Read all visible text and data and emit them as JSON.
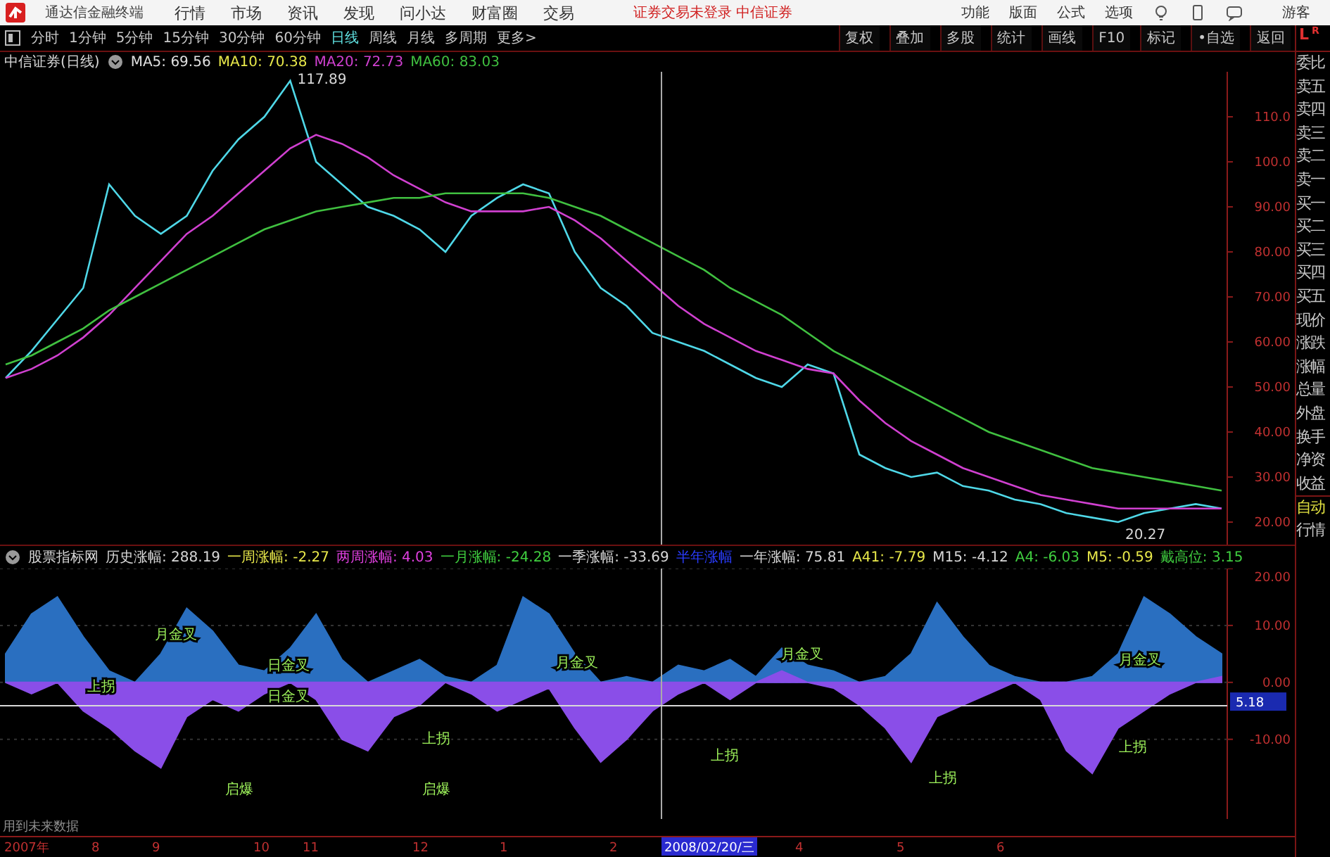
{
  "menu_bar": {
    "app_title": "通达信金融终端",
    "menus": [
      "行情",
      "市场",
      "资讯",
      "发现",
      "问小达",
      "财富圈",
      "交易"
    ],
    "notice": "证券交易未登录 中信证券",
    "right_menus": [
      "功能",
      "版面",
      "公式",
      "选项"
    ],
    "user": "游客"
  },
  "toolbar": {
    "periods": [
      {
        "label": "分时",
        "selected": false
      },
      {
        "label": "1分钟",
        "selected": false
      },
      {
        "label": "5分钟",
        "selected": false
      },
      {
        "label": "15分钟",
        "selected": false
      },
      {
        "label": "30分钟",
        "selected": false
      },
      {
        "label": "60分钟",
        "selected": false
      },
      {
        "label": "日线",
        "selected": true
      },
      {
        "label": "周线",
        "selected": false
      },
      {
        "label": "月线",
        "selected": false
      },
      {
        "label": "多周期",
        "selected": false
      },
      {
        "label": "更多>",
        "selected": false
      }
    ],
    "buttons": [
      "复权",
      "叠加",
      "多股",
      "统计",
      "画线",
      "F10",
      "标记",
      "•自选",
      "返回"
    ]
  },
  "price_pane": {
    "title": "中信证券(日线)",
    "legend": [
      {
        "text": "MA5: 69.56",
        "color": "#e0e0e0"
      },
      {
        "text": "MA10: 70.38",
        "color": "#e8e84a"
      },
      {
        "text": "MA20: 72.73",
        "color": "#d040d0"
      },
      {
        "text": "MA60: 83.03",
        "color": "#40c040"
      }
    ],
    "chart_data": {
      "type": "line",
      "ylim": [
        15,
        120
      ],
      "yticks": [
        {
          "value": 110,
          "label": "110.0"
        },
        {
          "value": 100,
          "label": "100.0"
        },
        {
          "value": 90,
          "label": "90.00"
        },
        {
          "value": 80,
          "label": "80.00"
        },
        {
          "value": 70,
          "label": "70.00"
        },
        {
          "value": 60,
          "label": "60.00"
        },
        {
          "value": 50,
          "label": "50.00"
        },
        {
          "value": 40,
          "label": "40.00"
        },
        {
          "value": 30,
          "label": "30.00"
        },
        {
          "value": 20,
          "label": "20.00"
        }
      ],
      "series": [
        {
          "color": "#4fd8e8",
          "values": [
            52,
            58,
            65,
            72,
            95,
            88,
            84,
            88,
            98,
            105,
            110,
            118,
            100,
            95,
            90,
            88,
            85,
            80,
            88,
            92,
            95,
            93,
            80,
            72,
            68,
            62,
            60,
            58,
            55,
            52,
            50,
            55,
            53,
            35,
            32,
            30,
            31,
            28,
            27,
            25,
            24,
            22,
            21,
            20,
            22,
            23,
            24,
            23
          ]
        },
        {
          "color": "#d040d0",
          "values": [
            52,
            54,
            57,
            61,
            66,
            72,
            78,
            84,
            88,
            93,
            98,
            103,
            106,
            104,
            101,
            97,
            94,
            91,
            89,
            89,
            89,
            90,
            87,
            83,
            78,
            73,
            68,
            64,
            61,
            58,
            56,
            54,
            53,
            47,
            42,
            38,
            35,
            32,
            30,
            28,
            26,
            25,
            24,
            23,
            23,
            23,
            23,
            23
          ]
        },
        {
          "color": "#40c040",
          "values": [
            55,
            57,
            60,
            63,
            67,
            70,
            73,
            76,
            79,
            82,
            85,
            87,
            89,
            90,
            91,
            92,
            92,
            93,
            93,
            93,
            93,
            92,
            90,
            88,
            85,
            82,
            79,
            76,
            72,
            69,
            66,
            62,
            58,
            55,
            52,
            49,
            46,
            43,
            40,
            38,
            36,
            34,
            32,
            31,
            30,
            29,
            28,
            27
          ]
        }
      ],
      "annotations": [
        "117.89",
        "20.27"
      ]
    }
  },
  "indicator_pane": {
    "title": "股票指标网",
    "legend": [
      {
        "text": "历史涨幅: 288.19",
        "color": "#d8d8d8"
      },
      {
        "text": "一周涨幅: -2.27",
        "color": "#e8e84a"
      },
      {
        "text": "两周涨幅: 4.03",
        "color": "#e040e0"
      },
      {
        "text": "一月涨幅: -24.28",
        "color": "#40d040"
      },
      {
        "text": "一季涨幅: -33.69",
        "color": "#d8d8d8"
      },
      {
        "text": "半年涨幅",
        "color": "#2a3cff"
      },
      {
        "text": "一年涨幅: 75.81",
        "color": "#d8d8d8"
      },
      {
        "text": "A41: -7.79",
        "color": "#e8e84a"
      },
      {
        "text": "M15: -4.12",
        "color": "#d8d8d8"
      },
      {
        "text": "A4: -6.03",
        "color": "#40d040"
      },
      {
        "text": "M5: -0.59",
        "color": "#e8e84a"
      },
      {
        "text": "戴高位: 3.15",
        "color": "#40d040"
      }
    ],
    "current_value": "5.18",
    "chart_data": {
      "type": "area",
      "ylim": [
        -24,
        20
      ],
      "grid": true,
      "yticks": [
        {
          "value": 20,
          "label": "20.00"
        },
        {
          "value": 10,
          "label": "10.00"
        },
        {
          "value": 0,
          "label": "0.00"
        },
        {
          "value": -10,
          "label": "-10.00"
        }
      ],
      "series": [
        {
          "color": "#2a6fc0",
          "values": [
            5,
            12,
            15,
            8,
            2,
            0,
            5,
            13,
            9,
            3,
            2,
            6,
            12,
            4,
            0,
            2,
            4,
            1,
            0,
            3,
            15,
            12,
            5,
            0,
            1,
            0,
            3,
            2,
            4,
            1,
            6,
            3,
            2,
            0,
            1,
            5,
            14,
            8,
            3,
            1,
            0,
            0,
            1,
            5,
            15,
            12,
            8,
            5
          ]
        },
        {
          "color": "#8a4ee8",
          "values": [
            0,
            -2,
            0,
            -5,
            -8,
            -12,
            -15,
            -6,
            -3,
            -5,
            -2,
            0,
            -3,
            -10,
            -12,
            -6,
            -4,
            0,
            -2,
            -5,
            -3,
            -1,
            -8,
            -14,
            -10,
            -5,
            -2,
            0,
            -3,
            0,
            2,
            0,
            -1,
            -4,
            -8,
            -14,
            -6,
            -4,
            -2,
            0,
            -3,
            -12,
            -16,
            -8,
            -5,
            -2,
            0,
            1
          ]
        }
      ],
      "annotations": [
        "上拐",
        "月金叉",
        "日金叉",
        "启爆",
        "启爆",
        "日金叉",
        "上拐",
        "月金叉",
        "上拐",
        "月金叉",
        "上拐",
        "上拐",
        "月金叉"
      ]
    }
  },
  "note": "用到未来数据",
  "time_axis": {
    "labels": [
      "2007年",
      "8",
      "9",
      "10",
      "11",
      "12",
      "1",
      "2",
      "4",
      "5",
      "6"
    ],
    "cursor_date": "2008/02/20/三"
  },
  "side_panel": {
    "tabs": [
      "L",
      "R"
    ],
    "items": [
      "委比",
      "卖五",
      "卖四",
      "卖三",
      "卖二",
      "卖一",
      "买一",
      "买二",
      "买三",
      "买四",
      "买五",
      "现价",
      "涨跌",
      "涨幅",
      "总量",
      "外盘",
      "换手",
      "净资",
      "收益"
    ],
    "bottom": [
      "自动",
      "行情"
    ]
  }
}
